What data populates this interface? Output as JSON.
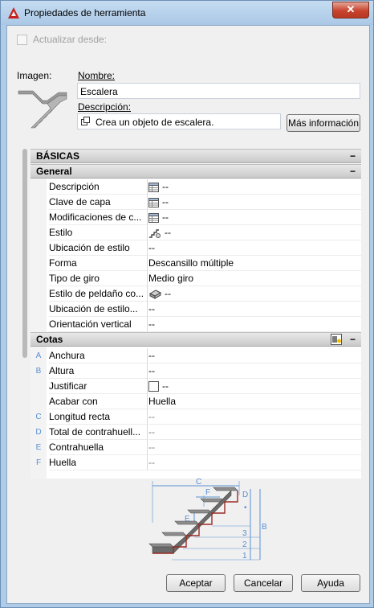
{
  "window": {
    "title": "Propiedades de herramienta",
    "close_glyph": "✕"
  },
  "header": {
    "update_from_label": "Actualizar desde:",
    "image_label": "Imagen:",
    "name_label": "Nombre:",
    "name_value": "Escalera",
    "description_label": "Descripción:",
    "description_value": "Crea un objeto de escalera.",
    "more_info_button": "Más información"
  },
  "sections": {
    "basicas": "BÁSICAS",
    "general": "General",
    "cotas": "Cotas",
    "collapse_glyph": "−"
  },
  "general_rows": [
    {
      "name": "Descripción",
      "value": "--",
      "icon": "table-icon"
    },
    {
      "name": "Clave de capa",
      "value": "--",
      "icon": "table-icon"
    },
    {
      "name": "Modificaciones de c...",
      "value": "--",
      "icon": "table-icon"
    },
    {
      "name": "Estilo",
      "value": "--",
      "icon": "stair-style-icon"
    },
    {
      "name": "Ubicación de estilo",
      "value": "--"
    },
    {
      "name": "Forma",
      "value": "Descansillo múltiple"
    },
    {
      "name": "Tipo de giro",
      "value": "Medio giro"
    },
    {
      "name": "Estilo de peldaño co...",
      "value": "--",
      "icon": "tread-style-icon"
    },
    {
      "name": "Ubicación de estilo...",
      "value": "--"
    },
    {
      "name": "Orientación vertical",
      "value": "--"
    }
  ],
  "cotas_rows": [
    {
      "letter": "A",
      "name": "Anchura",
      "value": "--"
    },
    {
      "letter": "B",
      "name": "Altura",
      "value": "--"
    },
    {
      "letter": "",
      "name": "Justificar",
      "value": "--",
      "icon": "checkbox-icon"
    },
    {
      "letter": "",
      "name": "Acabar con",
      "value": "Huella"
    },
    {
      "letter": "C",
      "name": "Longitud recta",
      "value": "--"
    },
    {
      "letter": "D",
      "name": "Total de contrahuell...",
      "value": "--"
    },
    {
      "letter": "E",
      "name": "Contrahuella",
      "value": "--"
    },
    {
      "letter": "F",
      "name": "Huella",
      "value": "--"
    }
  ],
  "diagram": {
    "labels": {
      "C": "C",
      "F": "F",
      "E": "E",
      "D": "D",
      "B": "B",
      "dot": "•",
      "n3": "3",
      "n2": "2",
      "n1": "1"
    }
  },
  "footer": {
    "accept": "Aceptar",
    "cancel": "Cancelar",
    "help": "Ayuda"
  },
  "colors": {
    "accent_blue": "#5a8fd0",
    "close_red": "#c8432c",
    "tread_red": "#9b2a22"
  }
}
